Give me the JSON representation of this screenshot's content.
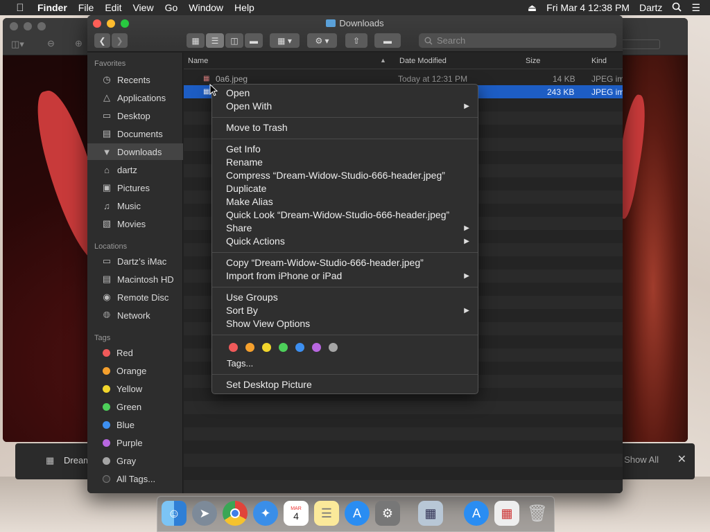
{
  "menubar": {
    "app": "Finder",
    "items": [
      "File",
      "Edit",
      "View",
      "Go",
      "Window",
      "Help"
    ],
    "datetime": "Fri Mar 4  12:38 PM",
    "user": "Dartz"
  },
  "finder": {
    "title": "Downloads",
    "search_placeholder": "Search"
  },
  "sidebar": {
    "favorites_header": "Favorites",
    "favorites": [
      {
        "label": "Recents",
        "icon": "clock-icon"
      },
      {
        "label": "Applications",
        "icon": "applications-icon"
      },
      {
        "label": "Desktop",
        "icon": "desktop-icon"
      },
      {
        "label": "Documents",
        "icon": "documents-icon"
      },
      {
        "label": "Downloads",
        "icon": "downloads-icon"
      },
      {
        "label": "dartz",
        "icon": "home-icon"
      },
      {
        "label": "Pictures",
        "icon": "camera-icon"
      },
      {
        "label": "Music",
        "icon": "music-icon"
      },
      {
        "label": "Movies",
        "icon": "film-icon"
      }
    ],
    "locations_header": "Locations",
    "locations": [
      {
        "label": "Dartz’s iMac",
        "icon": "imac-icon"
      },
      {
        "label": "Macintosh HD",
        "icon": "disk-icon"
      },
      {
        "label": "Remote Disc",
        "icon": "disc-icon"
      },
      {
        "label": "Network",
        "icon": "globe-icon"
      }
    ],
    "tags_header": "Tags",
    "tags": [
      {
        "label": "Red",
        "color": "#f05a5a"
      },
      {
        "label": "Orange",
        "color": "#f5a02d"
      },
      {
        "label": "Yellow",
        "color": "#f2d62c"
      },
      {
        "label": "Green",
        "color": "#4dcf5a"
      },
      {
        "label": "Blue",
        "color": "#3d8ff0"
      },
      {
        "label": "Purple",
        "color": "#b867e0"
      },
      {
        "label": "Gray",
        "color": "#a5a5a5"
      },
      {
        "label": "All Tags...",
        "color": "#3a3a3a"
      }
    ]
  },
  "columns": {
    "name": "Name",
    "date": "Date Modified",
    "size": "Size",
    "kind": "Kind"
  },
  "files": [
    {
      "name": "0a6.jpeg",
      "date": "Today at 12:31 PM",
      "size": "14 KB",
      "kind": "JPEG im"
    },
    {
      "name": "",
      "date": "",
      "size": "243 KB",
      "kind": "JPEG im"
    }
  ],
  "context_menu": {
    "open": "Open",
    "open_with": "Open With",
    "move_to_trash": "Move to Trash",
    "get_info": "Get Info",
    "rename": "Rename",
    "compress": "Compress “Dream-Widow-Studio-666-header.jpeg”",
    "duplicate": "Duplicate",
    "make_alias": "Make Alias",
    "quick_look": "Quick Look “Dream-Widow-Studio-666-header.jpeg”",
    "share": "Share",
    "quick_actions": "Quick Actions",
    "copy": "Copy “Dream-Widow-Studio-666-header.jpeg”",
    "import_iphone": "Import from iPhone or iPad",
    "use_groups": "Use Groups",
    "sort_by": "Sort By",
    "show_view_options": "Show View Options",
    "tag_colors": [
      "#f05a5a",
      "#f5a02d",
      "#f2d62c",
      "#4dcf5a",
      "#3d8ff0",
      "#b867e0",
      "#a5a5a5"
    ],
    "tags": "Tags...",
    "set_desktop_picture": "Set Desktop Picture"
  },
  "download_bar": {
    "file": "Dream-W",
    "show_all": "Show All"
  },
  "dock": [
    "finder-icon",
    "launchpad-icon",
    "chrome-icon",
    "safari-icon",
    "calendar-icon",
    "notes-icon",
    "app-store-icon",
    "system-preferences-icon",
    "preview-icon",
    "app-store-icon",
    "image-file-icon",
    "trash-icon"
  ],
  "dock_calendar": {
    "month": "MAR",
    "day": "4"
  }
}
